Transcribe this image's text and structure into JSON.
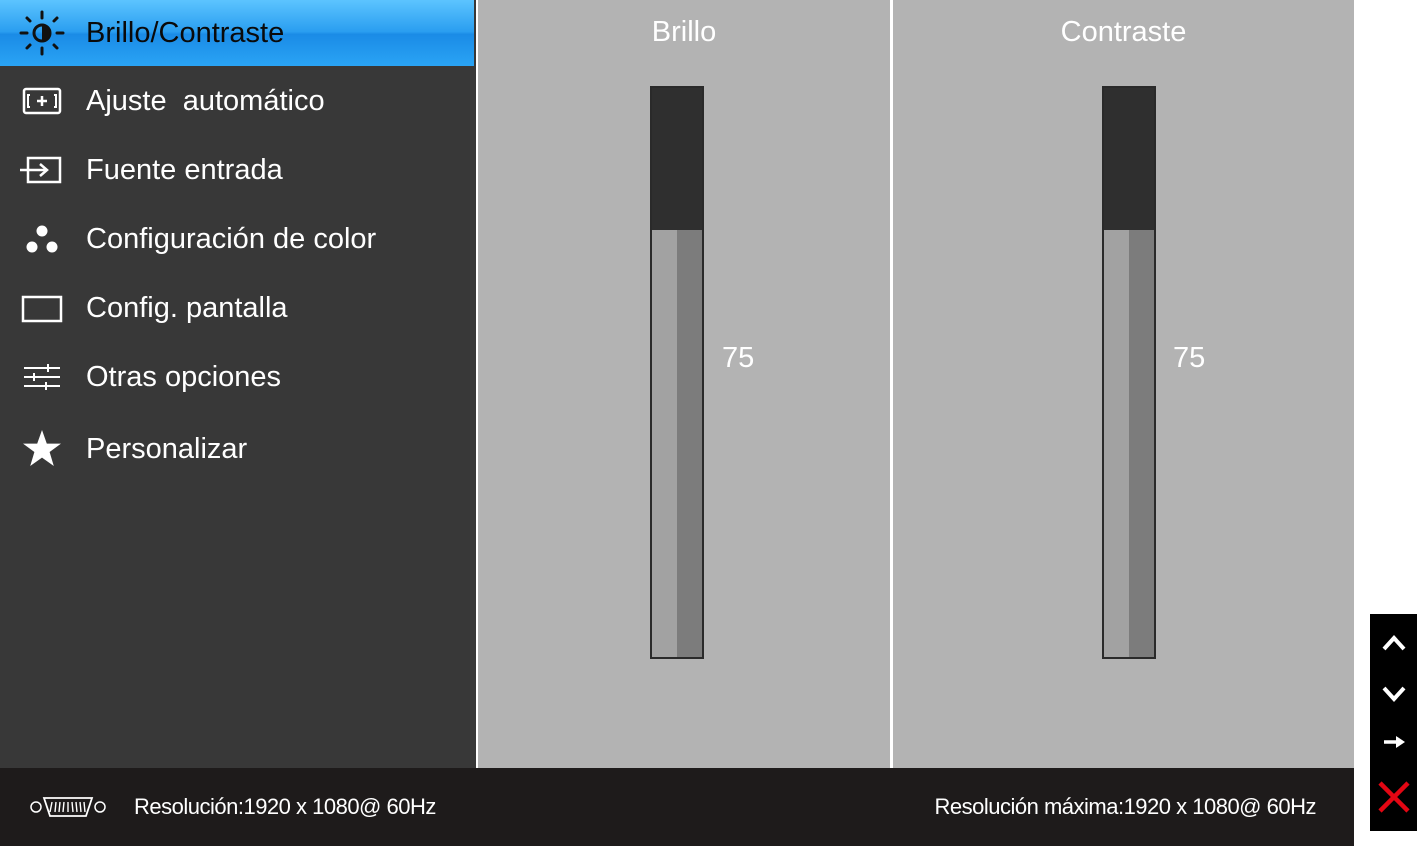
{
  "menu": {
    "items": [
      {
        "label": "Brillo/Contraste",
        "icon": "brightness-icon",
        "active": true
      },
      {
        "label": "Ajuste  automático",
        "icon": "auto-adjust-icon"
      },
      {
        "label": "Fuente entrada",
        "icon": "input-source-icon"
      },
      {
        "label": "Configuración de color",
        "icon": "color-dots-icon"
      },
      {
        "label": "Config. pantalla",
        "icon": "display-icon"
      },
      {
        "label": "Otras opciones",
        "icon": "sliders-icon"
      },
      {
        "label": "Personalizar",
        "icon": "star-icon"
      }
    ]
  },
  "brightness": {
    "title": "Brillo",
    "value": "75",
    "level": 75
  },
  "contrast": {
    "title": "Contraste",
    "value": "75",
    "level": 75
  },
  "footer": {
    "resolution": "Resolución:1920 x 1080@ 60Hz",
    "max_resolution": "Resolución máxima:1920 x 1080@ 60Hz",
    "input_icon": "vga-connector-icon"
  },
  "nav": {
    "buttons": [
      "up-icon",
      "down-icon",
      "enter-icon",
      "exit-icon"
    ]
  },
  "colors": {
    "active_accent": "#2a9ef0",
    "sidebar_bg": "#383838",
    "panel_bg": "#b3b3b3",
    "exit_red": "#e30613"
  }
}
